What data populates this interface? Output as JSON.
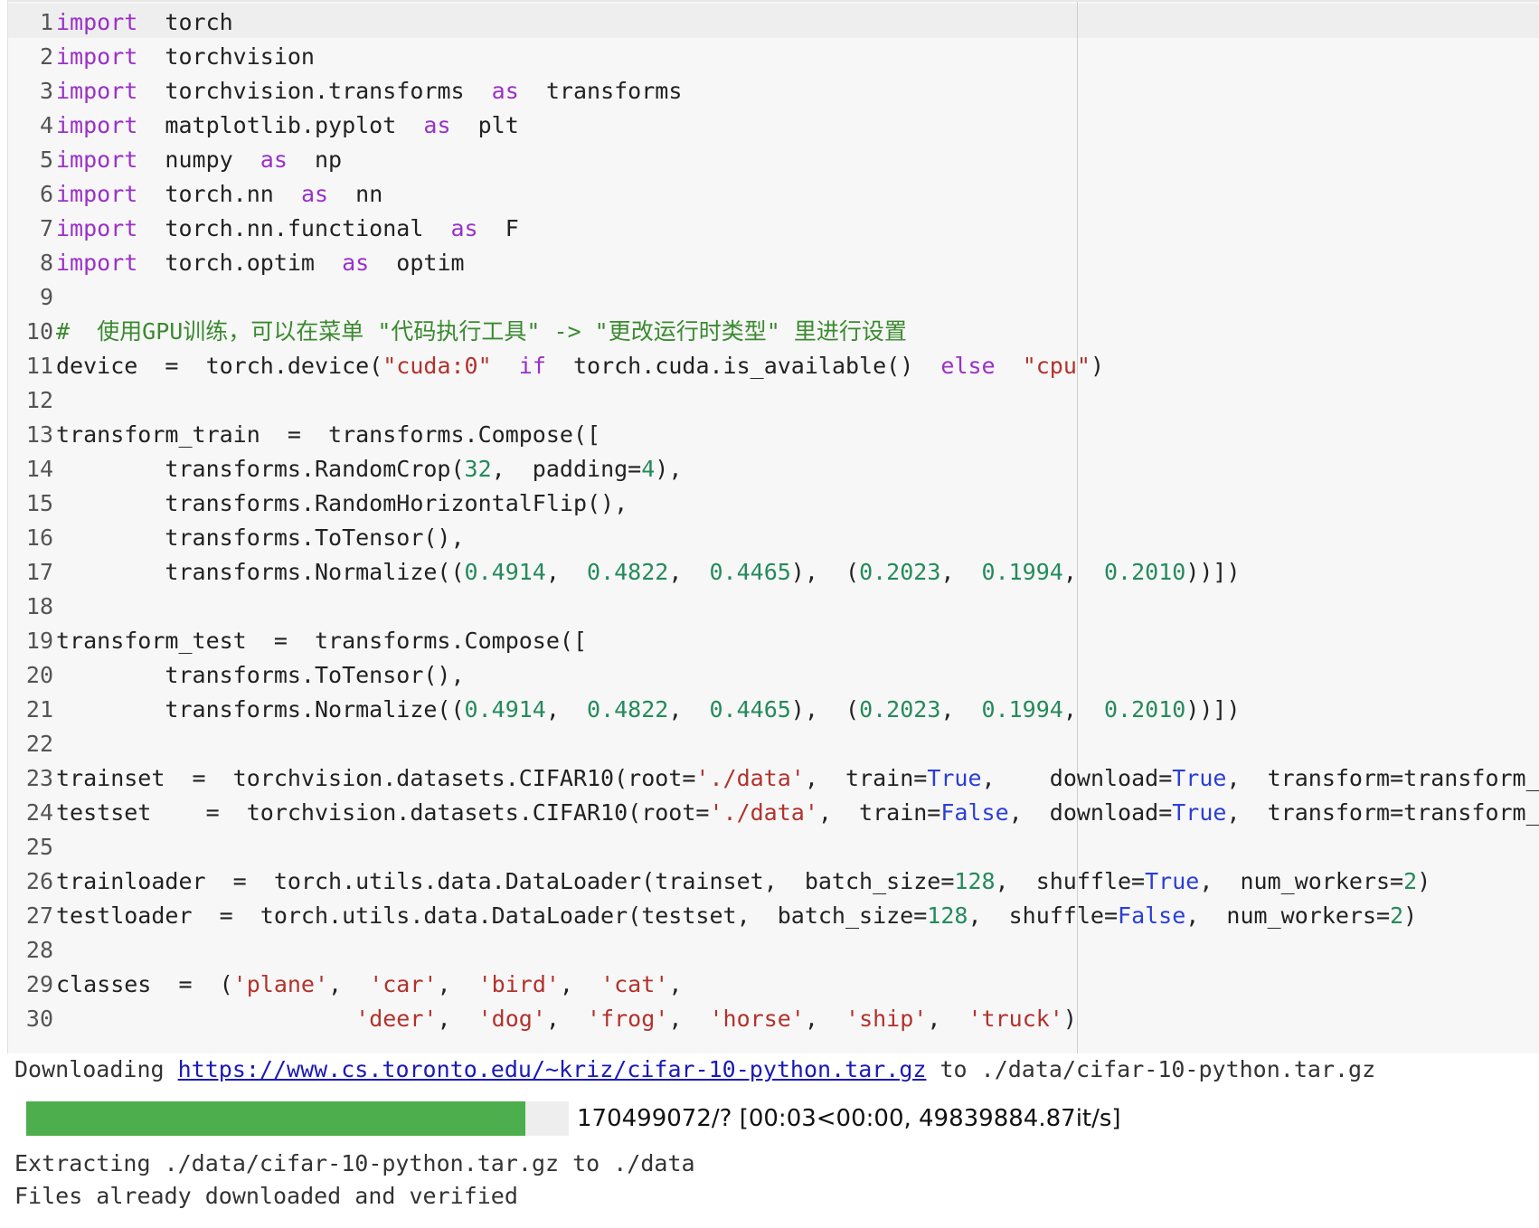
{
  "colors": {
    "keyword": "#9b30c8",
    "string": "#b2322c",
    "number": "#258a5c",
    "comment": "#3a8a2f",
    "constant": "#2a3fd6",
    "progress_fill": "#4cae4c"
  },
  "code_cell": {
    "lines": [
      {
        "no": "1",
        "tokens": [
          {
            "t": "kw",
            "v": "import"
          },
          {
            "t": "",
            "v": "  torch"
          }
        ]
      },
      {
        "no": "2",
        "tokens": [
          {
            "t": "kw",
            "v": "import"
          },
          {
            "t": "",
            "v": "  torchvision"
          }
        ]
      },
      {
        "no": "3",
        "tokens": [
          {
            "t": "kw",
            "v": "import"
          },
          {
            "t": "",
            "v": "  torchvision.transforms  "
          },
          {
            "t": "kw",
            "v": "as"
          },
          {
            "t": "",
            "v": "  transforms"
          }
        ]
      },
      {
        "no": "4",
        "tokens": [
          {
            "t": "kw",
            "v": "import"
          },
          {
            "t": "",
            "v": "  matplotlib.pyplot  "
          },
          {
            "t": "kw",
            "v": "as"
          },
          {
            "t": "",
            "v": "  plt"
          }
        ]
      },
      {
        "no": "5",
        "tokens": [
          {
            "t": "kw",
            "v": "import"
          },
          {
            "t": "",
            "v": "  numpy  "
          },
          {
            "t": "kw",
            "v": "as"
          },
          {
            "t": "",
            "v": "  np"
          }
        ]
      },
      {
        "no": "6",
        "tokens": [
          {
            "t": "kw",
            "v": "import"
          },
          {
            "t": "",
            "v": "  torch.nn  "
          },
          {
            "t": "kw",
            "v": "as"
          },
          {
            "t": "",
            "v": "  nn"
          }
        ]
      },
      {
        "no": "7",
        "tokens": [
          {
            "t": "kw",
            "v": "import"
          },
          {
            "t": "",
            "v": "  torch.nn.functional  "
          },
          {
            "t": "kw",
            "v": "as"
          },
          {
            "t": "",
            "v": "  F"
          }
        ]
      },
      {
        "no": "8",
        "tokens": [
          {
            "t": "kw",
            "v": "import"
          },
          {
            "t": "",
            "v": "  torch.optim  "
          },
          {
            "t": "kw",
            "v": "as"
          },
          {
            "t": "",
            "v": "  optim"
          }
        ]
      },
      {
        "no": "9",
        "tokens": []
      },
      {
        "no": "10",
        "tokens": [
          {
            "t": "cmt",
            "v": "#  使用GPU训练，可以在菜单 \"代码执行工具\" -> \"更改运行时类型\" 里进行设置"
          }
        ]
      },
      {
        "no": "11",
        "tokens": [
          {
            "t": "",
            "v": "device  =  torch.device("
          },
          {
            "t": "str",
            "v": "\"cuda:0\""
          },
          {
            "t": "",
            "v": "  "
          },
          {
            "t": "kw",
            "v": "if"
          },
          {
            "t": "",
            "v": "  torch.cuda.is_available()  "
          },
          {
            "t": "kw",
            "v": "else"
          },
          {
            "t": "",
            "v": "  "
          },
          {
            "t": "str",
            "v": "\"cpu\""
          },
          {
            "t": "",
            "v": ")"
          }
        ]
      },
      {
        "no": "12",
        "tokens": []
      },
      {
        "no": "13",
        "tokens": [
          {
            "t": "",
            "v": "transform_train  =  transforms.Compose(["
          }
        ]
      },
      {
        "no": "14",
        "tokens": [
          {
            "t": "",
            "v": "        transforms.RandomCrop("
          },
          {
            "t": "num",
            "v": "32"
          },
          {
            "t": "",
            "v": ",  padding="
          },
          {
            "t": "num",
            "v": "4"
          },
          {
            "t": "",
            "v": "),"
          }
        ]
      },
      {
        "no": "15",
        "tokens": [
          {
            "t": "",
            "v": "        transforms.RandomHorizontalFlip(),"
          }
        ]
      },
      {
        "no": "16",
        "tokens": [
          {
            "t": "",
            "v": "        transforms.ToTensor(),"
          }
        ]
      },
      {
        "no": "17",
        "tokens": [
          {
            "t": "",
            "v": "        transforms.Normalize(("
          },
          {
            "t": "num",
            "v": "0.4914"
          },
          {
            "t": "",
            "v": ",  "
          },
          {
            "t": "num",
            "v": "0.4822"
          },
          {
            "t": "",
            "v": ",  "
          },
          {
            "t": "num",
            "v": "0.4465"
          },
          {
            "t": "",
            "v": "),  ("
          },
          {
            "t": "num",
            "v": "0.2023"
          },
          {
            "t": "",
            "v": ",  "
          },
          {
            "t": "num",
            "v": "0.1994"
          },
          {
            "t": "",
            "v": ",  "
          },
          {
            "t": "num",
            "v": "0.2010"
          },
          {
            "t": "",
            "v": "))])"
          }
        ]
      },
      {
        "no": "18",
        "tokens": []
      },
      {
        "no": "19",
        "tokens": [
          {
            "t": "",
            "v": "transform_test  =  transforms.Compose(["
          }
        ]
      },
      {
        "no": "20",
        "tokens": [
          {
            "t": "",
            "v": "        transforms.ToTensor(),"
          }
        ]
      },
      {
        "no": "21",
        "tokens": [
          {
            "t": "",
            "v": "        transforms.Normalize(("
          },
          {
            "t": "num",
            "v": "0.4914"
          },
          {
            "t": "",
            "v": ",  "
          },
          {
            "t": "num",
            "v": "0.4822"
          },
          {
            "t": "",
            "v": ",  "
          },
          {
            "t": "num",
            "v": "0.4465"
          },
          {
            "t": "",
            "v": "),  ("
          },
          {
            "t": "num",
            "v": "0.2023"
          },
          {
            "t": "",
            "v": ",  "
          },
          {
            "t": "num",
            "v": "0.1994"
          },
          {
            "t": "",
            "v": ",  "
          },
          {
            "t": "num",
            "v": "0.2010"
          },
          {
            "t": "",
            "v": "))])"
          }
        ]
      },
      {
        "no": "22",
        "tokens": []
      },
      {
        "no": "23",
        "tokens": [
          {
            "t": "",
            "v": "trainset  =  torchvision.datasets.CIFAR10(root="
          },
          {
            "t": "str",
            "v": "'./data'"
          },
          {
            "t": "",
            "v": ",  train="
          },
          {
            "t": "kwv",
            "v": "True"
          },
          {
            "t": "",
            "v": ",    download="
          },
          {
            "t": "kwv",
            "v": "True"
          },
          {
            "t": "",
            "v": ",  transform=transform_train)"
          }
        ]
      },
      {
        "no": "24",
        "tokens": [
          {
            "t": "",
            "v": "testset    =  torchvision.datasets.CIFAR10(root="
          },
          {
            "t": "str",
            "v": "'./data'"
          },
          {
            "t": "",
            "v": ",  train="
          },
          {
            "t": "kwv",
            "v": "False"
          },
          {
            "t": "",
            "v": ",  download="
          },
          {
            "t": "kwv",
            "v": "True"
          },
          {
            "t": "",
            "v": ",  transform=transform_test)"
          }
        ]
      },
      {
        "no": "25",
        "tokens": []
      },
      {
        "no": "26",
        "tokens": [
          {
            "t": "",
            "v": "trainloader  =  torch.utils.data.DataLoader(trainset,  batch_size="
          },
          {
            "t": "num",
            "v": "128"
          },
          {
            "t": "",
            "v": ",  shuffle="
          },
          {
            "t": "kwv",
            "v": "True"
          },
          {
            "t": "",
            "v": ",  num_workers="
          },
          {
            "t": "num",
            "v": "2"
          },
          {
            "t": "",
            "v": ")"
          }
        ]
      },
      {
        "no": "27",
        "tokens": [
          {
            "t": "",
            "v": "testloader  =  torch.utils.data.DataLoader(testset,  batch_size="
          },
          {
            "t": "num",
            "v": "128"
          },
          {
            "t": "",
            "v": ",  shuffle="
          },
          {
            "t": "kwv",
            "v": "False"
          },
          {
            "t": "",
            "v": ",  num_workers="
          },
          {
            "t": "num",
            "v": "2"
          },
          {
            "t": "",
            "v": ")"
          }
        ]
      },
      {
        "no": "28",
        "tokens": []
      },
      {
        "no": "29",
        "tokens": [
          {
            "t": "",
            "v": "classes  =  ("
          },
          {
            "t": "str",
            "v": "'plane'"
          },
          {
            "t": "",
            "v": ",  "
          },
          {
            "t": "str",
            "v": "'car'"
          },
          {
            "t": "",
            "v": ",  "
          },
          {
            "t": "str",
            "v": "'bird'"
          },
          {
            "t": "",
            "v": ",  "
          },
          {
            "t": "str",
            "v": "'cat'"
          },
          {
            "t": "",
            "v": ","
          }
        ]
      },
      {
        "no": "30",
        "tokens": [
          {
            "t": "",
            "v": "                      "
          },
          {
            "t": "str",
            "v": "'deer'"
          },
          {
            "t": "",
            "v": ",  "
          },
          {
            "t": "str",
            "v": "'dog'"
          },
          {
            "t": "",
            "v": ",  "
          },
          {
            "t": "str",
            "v": "'frog'"
          },
          {
            "t": "",
            "v": ",  "
          },
          {
            "t": "str",
            "v": "'horse'"
          },
          {
            "t": "",
            "v": ",  "
          },
          {
            "t": "str",
            "v": "'ship'"
          },
          {
            "t": "",
            "v": ",  "
          },
          {
            "t": "str",
            "v": "'truck'"
          },
          {
            "t": "",
            "v": ")"
          }
        ]
      }
    ]
  },
  "output": {
    "download_prefix": "Downloading ",
    "download_url": "https://www.cs.toronto.edu/~kriz/cifar-10-python.tar.gz",
    "download_suffix": " to ./data/cifar-10-python.tar.gz",
    "progress_fraction": 1.0,
    "progress_text": "170499072/? [00:03<00:00, 49839884.87it/s]",
    "extract_line": "Extracting ./data/cifar-10-python.tar.gz to ./data",
    "verified_line": "Files already downloaded and verified"
  }
}
